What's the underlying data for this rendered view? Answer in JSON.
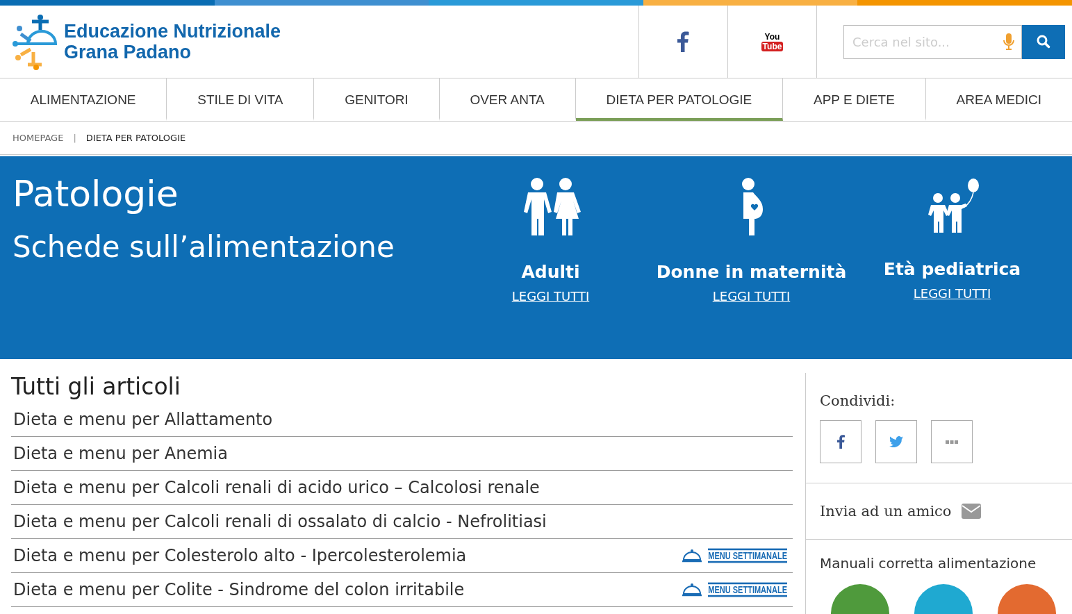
{
  "top_stripe": [
    {
      "color": "#0a6db3"
    },
    {
      "color": "#3f8fd0"
    },
    {
      "color": "#2a9ad8"
    },
    {
      "color": "#f8b043"
    },
    {
      "color": "#f49500"
    }
  ],
  "logo": {
    "line_1": "Educazione Nutrizionale",
    "line_2": "Grana Padano"
  },
  "youtube_logo": {
    "top": "You",
    "bottom": "Tube"
  },
  "search": {
    "placeholder": "Cerca nel sito..."
  },
  "nav": [
    {
      "label": "ALIMENTAZIONE",
      "selected": false
    },
    {
      "label": "STILE DI VITA",
      "selected": false
    },
    {
      "label": "GENITORI",
      "selected": false
    },
    {
      "label": "OVER ANTA",
      "selected": false
    },
    {
      "label": "DIETA PER PATOLOGIE",
      "selected": true
    },
    {
      "label": "APP E DIETE",
      "selected": false
    },
    {
      "label": "AREA MEDICI",
      "selected": false
    }
  ],
  "breadcrumb": [
    "HOMEPAGE",
    "DIETA PER PATOLOGIE"
  ],
  "breadcrumb_separator": "|",
  "hero": {
    "title": "Patologie",
    "subtitle": "Schede sull’alimentazione",
    "categories": [
      {
        "kind": "adults",
        "name": "Adulti",
        "link": "LEGGI TUTTI"
      },
      {
        "kind": "pregnant",
        "name": "Donne in maternità",
        "link": "LEGGI TUTTI"
      },
      {
        "kind": "children",
        "name": "Età pediatrica",
        "link": "LEGGI TUTTI"
      }
    ]
  },
  "articles": {
    "title": "Tutti gli articoli",
    "items": [
      {
        "title": "Dieta e menu per Allattamento"
      },
      {
        "title": "Dieta e menu per Anemia"
      },
      {
        "title": "Dieta e menu per Calcoli renali di acido urico – Calcolosi renale"
      },
      {
        "title": "Dieta e menu per Calcoli renali di ossalato di calcio - Nefrolitiasi"
      },
      {
        "title": "Dieta e menu per Colesterolo alto - Ipercolesterolemia",
        "badge": "MENU SETTIMANALE"
      },
      {
        "title": "Dieta e menu per Colite - Sindrome del colon irritabile",
        "badge": "MENU SETTIMANALE"
      }
    ]
  },
  "sidebar": {
    "share_label": "Condividi:",
    "send_label": "Invia ad un amico",
    "manuals_title": "Manuali corretta alimentazione",
    "covers": [
      {
        "color": "#4f9a3c"
      },
      {
        "color": "#1fa9d1"
      },
      {
        "color": "#e36a30"
      }
    ]
  }
}
